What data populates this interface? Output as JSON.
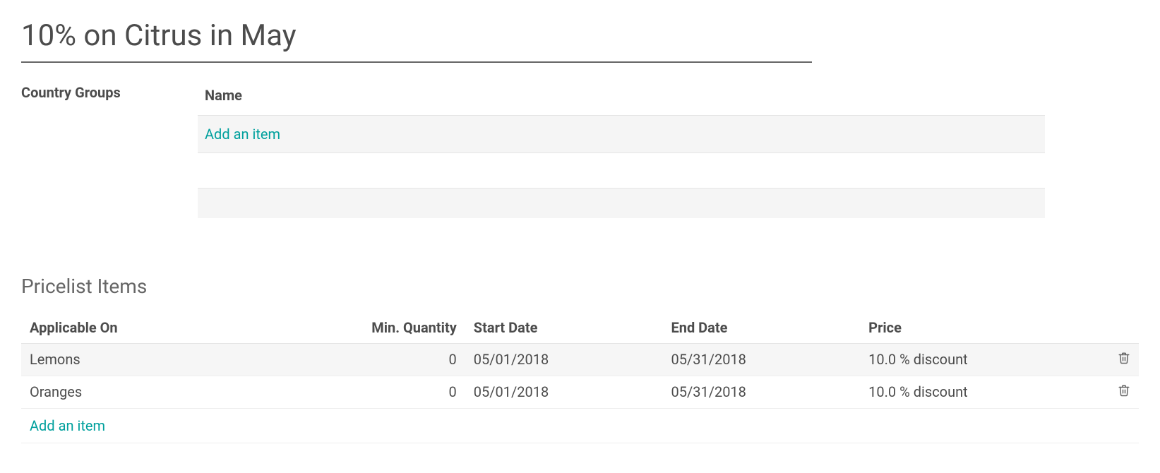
{
  "title": "10% on Citrus in May",
  "countryGroups": {
    "label": "Country Groups",
    "columns": {
      "name": "Name"
    },
    "addItemLabel": "Add an item"
  },
  "pricelist": {
    "sectionTitle": "Pricelist Items",
    "columns": {
      "applicableOn": "Applicable On",
      "minQuantity": "Min. Quantity",
      "startDate": "Start Date",
      "endDate": "End Date",
      "price": "Price"
    },
    "items": [
      {
        "applicableOn": "Lemons",
        "minQuantity": "0",
        "startDate": "05/01/2018",
        "endDate": "05/31/2018",
        "price": "10.0 % discount"
      },
      {
        "applicableOn": "Oranges",
        "minQuantity": "0",
        "startDate": "05/01/2018",
        "endDate": "05/31/2018",
        "price": "10.0 % discount"
      }
    ],
    "addItemLabel": "Add an item"
  }
}
